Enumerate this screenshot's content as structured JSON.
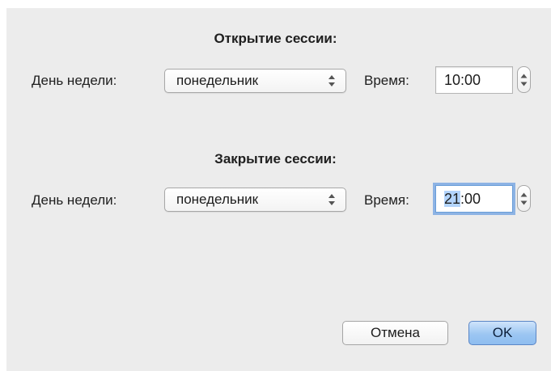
{
  "open_session": {
    "title": "Открытие сессии:",
    "weekday_label": "День недели:",
    "weekday_value": "понедельник",
    "time_label": "Время:",
    "time_hours": "10",
    "time_rest": ":00"
  },
  "close_session": {
    "title": "Закрытие сессии:",
    "weekday_label": "День недели:",
    "weekday_value": "понедельник",
    "time_label": "Время:",
    "time_hours": "21",
    "time_rest": ":00"
  },
  "buttons": {
    "cancel": "Отмена",
    "ok": "OK"
  },
  "colors": {
    "dialog_bg": "#ececec",
    "focus_ring": "#6ea0e1",
    "selection": "#b3d4fc",
    "ok_button": "#9cc6f2"
  }
}
